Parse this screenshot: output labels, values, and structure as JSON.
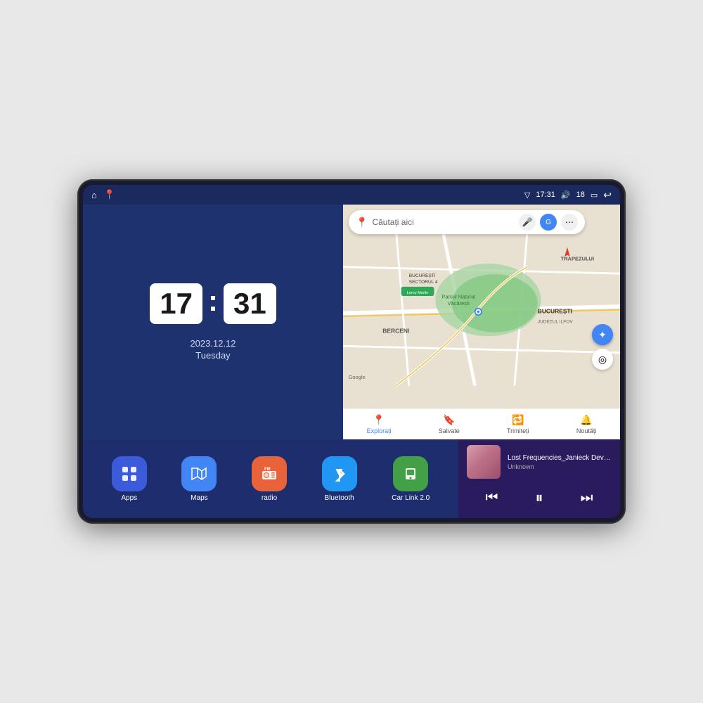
{
  "device": {
    "status_bar": {
      "left_icons": [
        "home",
        "maps"
      ],
      "time": "17:31",
      "volume_icon": "🔊",
      "battery_level": "18",
      "battery_icon": "🔋",
      "back_icon": "↩"
    },
    "clock": {
      "hour": "17",
      "minute": "31",
      "date": "2023.12.12",
      "day": "Tuesday"
    },
    "map": {
      "search_placeholder": "Căutați aici",
      "labels": {
        "berceni": "BERCENI",
        "trapezului": "TRAPEZULUI",
        "bucuresti": "BUCUREȘTI",
        "judetul_ilfov": "JUDEȚUL ILFOV",
        "parcul": "Parcul Natural Văcărești",
        "leroy": "Leroy Merlin",
        "sectorul4": "BUCUREȘTI\nSECTORUL 4",
        "google": "Google"
      },
      "nav_items": [
        {
          "id": "explora",
          "icon": "📍",
          "label": "Explorați",
          "active": true
        },
        {
          "id": "salvate",
          "icon": "🔖",
          "label": "Salvate",
          "active": false
        },
        {
          "id": "trimiteti",
          "icon": "🔁",
          "label": "Trimiteți",
          "active": false
        },
        {
          "id": "noutati",
          "icon": "🔔",
          "label": "Noutăți",
          "active": false
        }
      ]
    },
    "apps": [
      {
        "id": "apps",
        "icon": "⊞",
        "label": "Apps",
        "bg": "#3b5bdb"
      },
      {
        "id": "maps",
        "icon": "📍",
        "label": "Maps",
        "bg": "#4285f4"
      },
      {
        "id": "radio",
        "icon": "📻",
        "label": "radio",
        "bg": "#e8623a"
      },
      {
        "id": "bluetooth",
        "icon": "📶",
        "label": "Bluetooth",
        "bg": "#2196f3"
      },
      {
        "id": "carlink",
        "icon": "📱",
        "label": "Car Link 2.0",
        "bg": "#43a047"
      }
    ],
    "music": {
      "title": "Lost Frequencies_Janieck Devy-...",
      "artist": "Unknown",
      "controls": {
        "prev": "⏮",
        "play": "⏸",
        "next": "⏭"
      }
    }
  }
}
